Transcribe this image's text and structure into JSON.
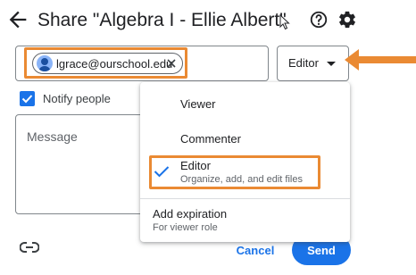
{
  "dialog": {
    "title": "Share \"Algebra I - Ellie Albert\"",
    "icons": {
      "back": "arrow-left-icon",
      "help": "help-circle-icon",
      "settings": "gear-icon"
    }
  },
  "people": {
    "chip_email": "lgrace@ourschool.edu",
    "chip_icons": {
      "avatar": "person-avatar-icon",
      "remove": "close-icon"
    }
  },
  "role_select": {
    "selected": "Editor",
    "caret_icon": "caret-down-icon"
  },
  "notify": {
    "label": "Notify people",
    "checked": true
  },
  "message": {
    "placeholder": "Message"
  },
  "footer": {
    "link_icon": "link-icon",
    "cancel_label": "Cancel",
    "send_label": "Send"
  },
  "menu": {
    "items": [
      {
        "label": "Viewer"
      },
      {
        "label": "Commenter"
      },
      {
        "label": "Editor",
        "description": "Organize, add, and edit files",
        "selected": true
      }
    ],
    "expiration": {
      "label": "Add expiration",
      "description": "For viewer role"
    }
  },
  "colors": {
    "accent": "#1a73e8",
    "highlight": "#ea8a33",
    "text": "#202124",
    "secondary_text": "#5f6368"
  }
}
